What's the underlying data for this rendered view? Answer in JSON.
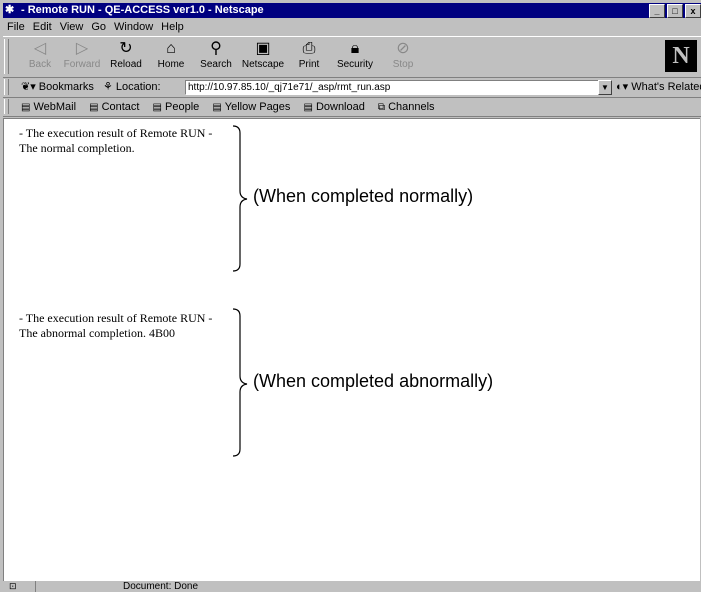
{
  "window": {
    "title": "- Remote RUN - QE-ACCESS ver1.0 - Netscape",
    "controls": [
      "_",
      "□",
      "x"
    ]
  },
  "menu": [
    "File",
    "Edit",
    "View",
    "Go",
    "Window",
    "Help"
  ],
  "toolbar": {
    "back": "Back",
    "forward": "Forward",
    "reload": "Reload",
    "home": "Home",
    "search": "Search",
    "netscape": "Netscape",
    "print": "Print",
    "security": "Security",
    "stop": "Stop",
    "logo": "N"
  },
  "location": {
    "bookmarks": "Bookmarks",
    "label": "Location:",
    "url": "http://10.97.85.10/_qj71e71/_asp/rmt_run.asp",
    "related": "What's Related"
  },
  "personal": [
    "WebMail",
    "Contact",
    "People",
    "Yellow Pages",
    "Download",
    "Channels"
  ],
  "results": [
    {
      "line1": "- The execution result of Remote RUN -",
      "line2": "The normal completion.",
      "annotation": "(When completed normally)"
    },
    {
      "line1": "- The execution result of Remote RUN -",
      "line2": "The abnormal completion. 4B00",
      "annotation": "(When completed abnormally)"
    }
  ],
  "status": {
    "text": "Document: Done"
  }
}
